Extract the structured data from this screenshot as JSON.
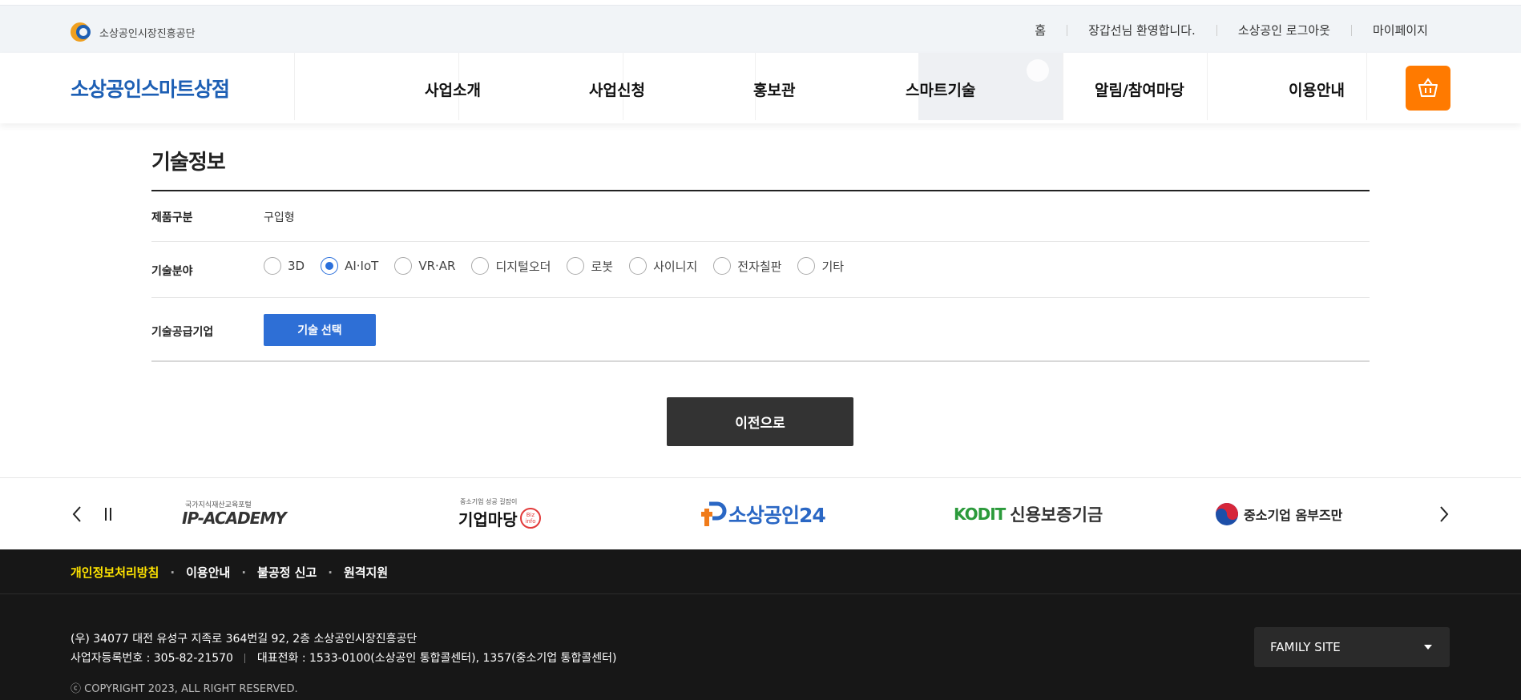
{
  "header": {
    "org_name": "소상공인시장진흥공단",
    "util_links": [
      "홈",
      "장갑선님 환영합니다.",
      "소상공인 로그아웃",
      "마이페이지"
    ],
    "brand": "소상공인스마트상점",
    "menu": [
      "사업소개",
      "사업신청",
      "홍보관",
      "스마트기술",
      "알림/참여마당",
      "이용안내"
    ],
    "cart_icon": "basket-icon"
  },
  "section": {
    "title": "기술정보",
    "product_label": "제품구분",
    "product_value": "구입형",
    "field_label": "기술분야",
    "fields": [
      {
        "label": "3D",
        "selected": false
      },
      {
        "label": "AI·IoT",
        "selected": true
      },
      {
        "label": "VR·AR",
        "selected": false
      },
      {
        "label": "디지털오더",
        "selected": false
      },
      {
        "label": "로봇",
        "selected": false
      },
      {
        "label": "사이니지",
        "selected": false
      },
      {
        "label": "전자칠판",
        "selected": false
      },
      {
        "label": "기타",
        "selected": false
      }
    ],
    "supplier_label": "기술공급기업",
    "select_button": "기술 선택",
    "prev_button": "이전으로"
  },
  "banner": {
    "logos": [
      "IP-ACADEMY",
      "기업마당",
      "소상공인24",
      "신용보증기금",
      "중소기업 옴부즈만"
    ],
    "ip_caption": "국가지식재산교육포털",
    "biz_caption": "중소기업 성공 길잡이",
    "biz_badge": "Biz info",
    "kodit_mark": "KODIT"
  },
  "footer": {
    "links": [
      "개인정보처리방침",
      "이용안내",
      "불공정 신고",
      "원격지원"
    ],
    "address": "(우) 34077 대전 유성구 지족로 364번길 92, 2층 소상공인시장진흥공단",
    "biz_no": "사업자등록번호 : 305-82-21570",
    "phone": "대표전화 : 1533-0100(소상공인 통합콜센터), 1357(중소기업 통합콜센터)",
    "copyright": "ⓒ COPYRIGHT 2023, ALL RIGHT RESERVED.",
    "family_site": "FAMILY SITE"
  },
  "colors": {
    "brand": "#1d5fb4",
    "accent": "#ff7a00",
    "radio": "#2a6fdb",
    "button": "#2e6fd6"
  }
}
